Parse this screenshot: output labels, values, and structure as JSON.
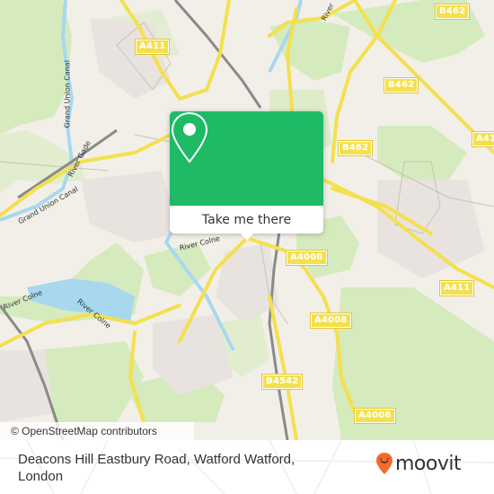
{
  "map": {
    "road_labels": [
      {
        "id": "a411-top",
        "text": "A411"
      },
      {
        "id": "b462-top-right",
        "text": "B462"
      },
      {
        "id": "b462-mid",
        "text": "B462"
      },
      {
        "id": "b462-right",
        "text": "B462"
      },
      {
        "id": "a41-right",
        "text": "A41"
      },
      {
        "id": "a4008-center",
        "text": "A4008"
      },
      {
        "id": "a411-right",
        "text": "A411"
      },
      {
        "id": "a4008-mid",
        "text": "A4008"
      },
      {
        "id": "b4542",
        "text": "B4542"
      },
      {
        "id": "a4008-bottom",
        "text": "A4008"
      }
    ],
    "water_labels": [
      {
        "id": "grand-union-canal-1",
        "text": "Grand Union Canal"
      },
      {
        "id": "river-gade",
        "text": "River Gade"
      },
      {
        "id": "grand-union-canal-2",
        "text": "Grand Union Canal"
      },
      {
        "id": "river-colne-1",
        "text": "River Colne"
      },
      {
        "id": "river-colne-2",
        "text": "River Colne"
      },
      {
        "id": "river-colne-3",
        "text": "River Colne"
      },
      {
        "id": "river-top",
        "text": "River"
      }
    ],
    "colors": {
      "land": "#f2efe9",
      "park": "#cfe8b3",
      "water": "#a8d8ee",
      "road_major": "#f4e04d",
      "brand_green": "#1fba66",
      "brand_orange": "#f26b2e"
    }
  },
  "popup": {
    "button_label": "Take me there",
    "icon": "map-pin-icon"
  },
  "attribution": "© OpenStreetMap contributors",
  "footer": {
    "address": "Deacons Hill Eastbury Road, Watford Watford, London",
    "logo_text": "moovit"
  }
}
